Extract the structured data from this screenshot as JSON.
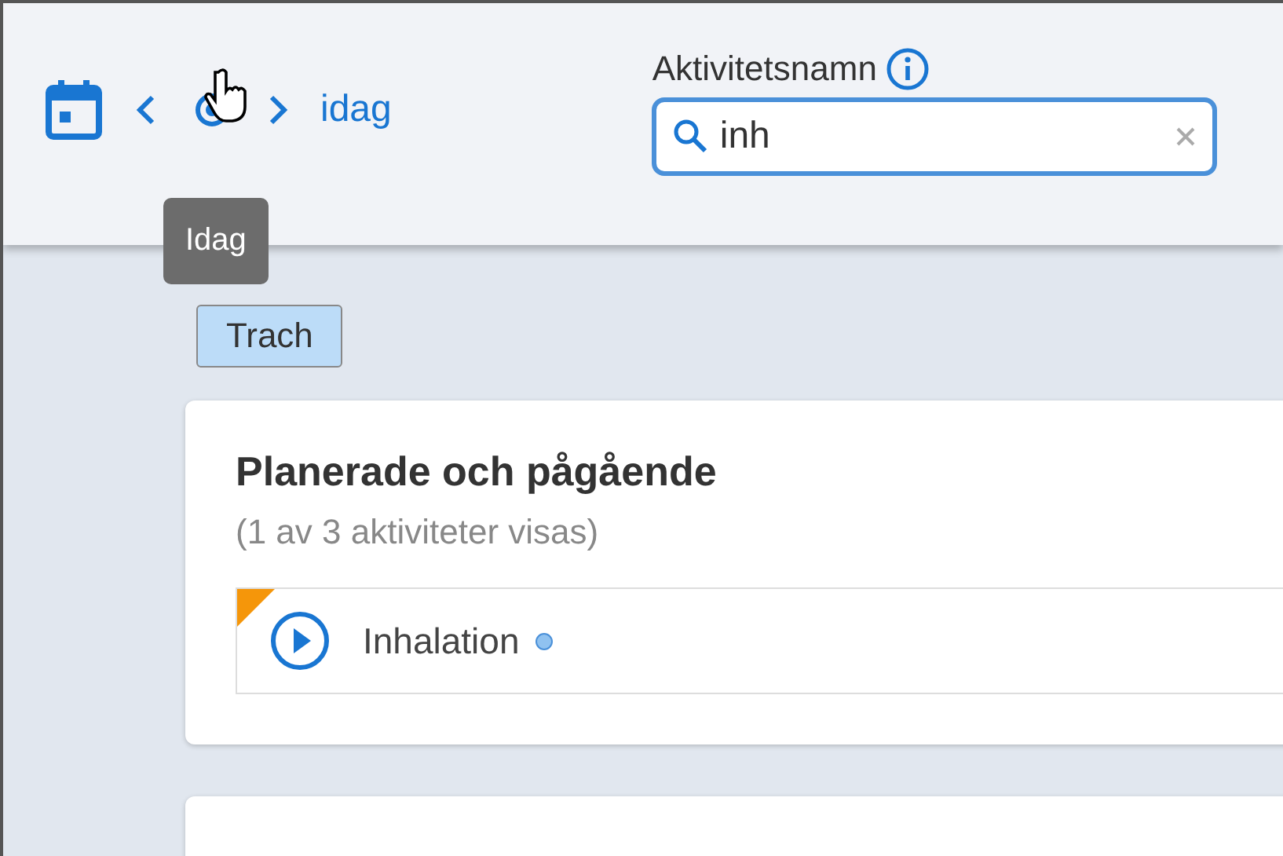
{
  "nav": {
    "today_link": "idag",
    "tooltip": "Idag"
  },
  "search": {
    "label": "Aktivitetsnamn",
    "value": "inh"
  },
  "filter_tag": "Trach",
  "sections": [
    {
      "title": "Planerade och pågående",
      "subtitle": "(1 av 3 aktiviteter visas)",
      "activities": [
        {
          "name": "Inhalation",
          "flagged": true,
          "color": "#90c2f0"
        }
      ]
    }
  ]
}
